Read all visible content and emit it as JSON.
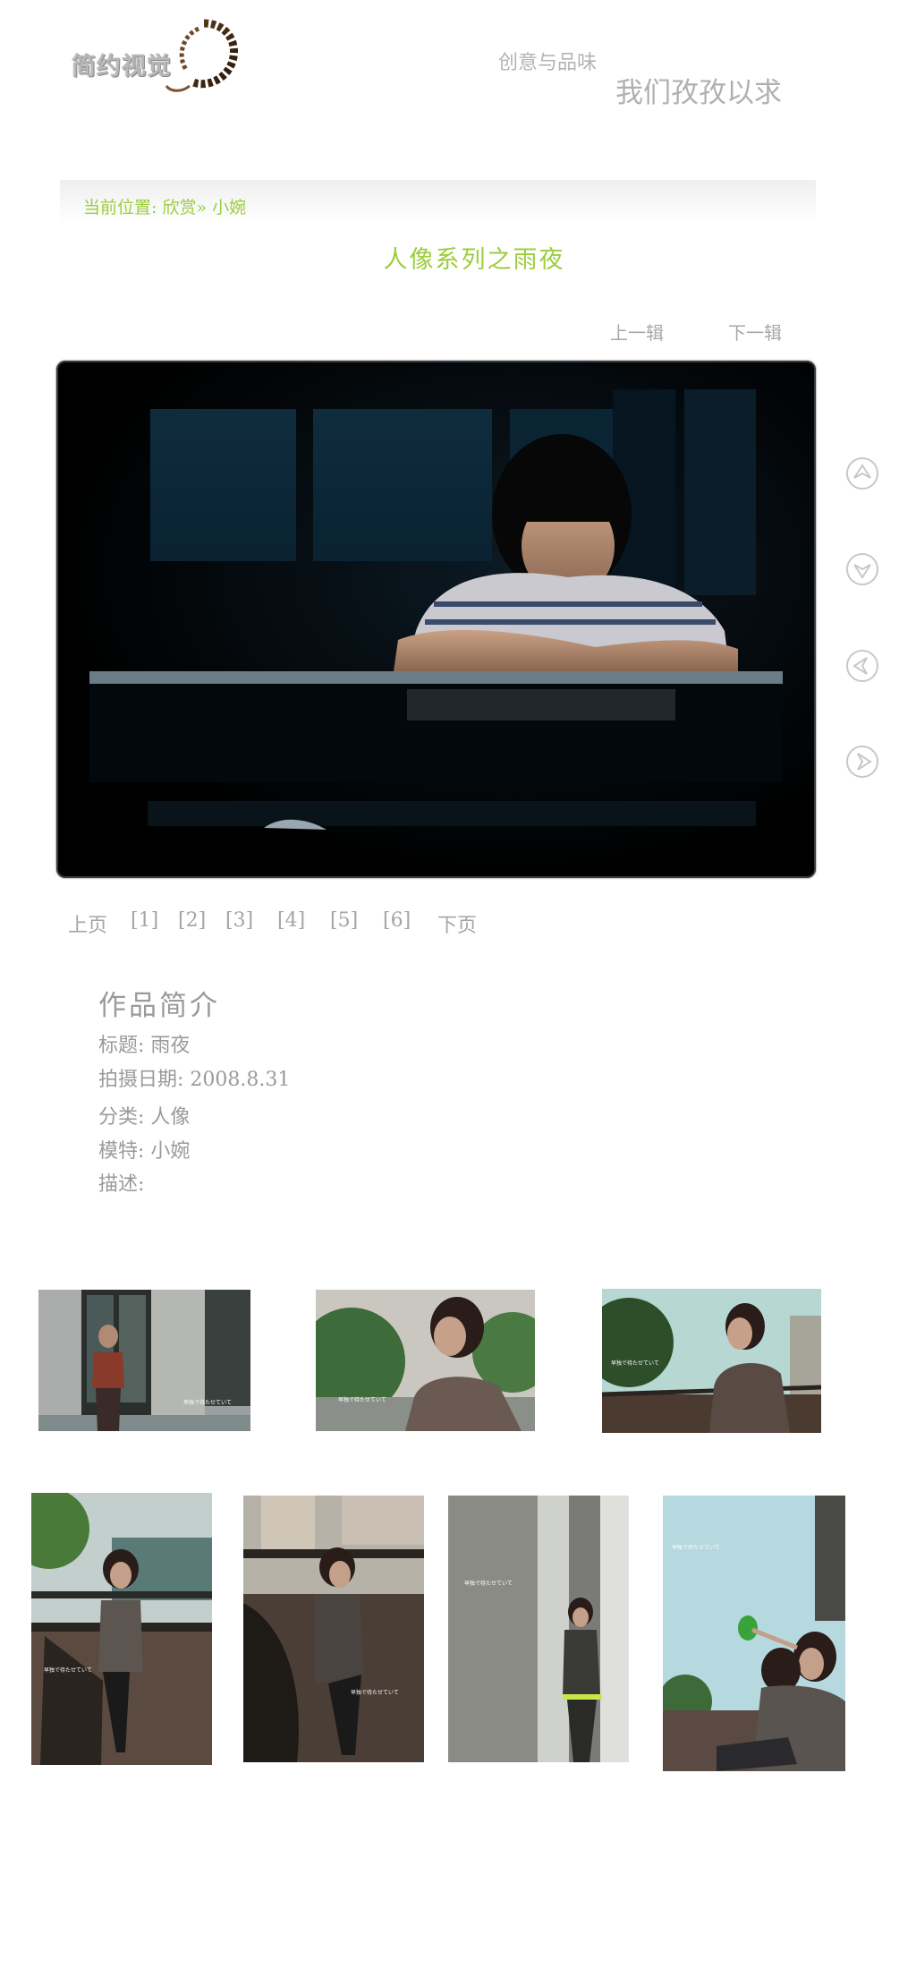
{
  "header": {
    "logo_text": "简约视觉",
    "tagline_small": "创意与品味",
    "tagline_big": "我们孜孜以求"
  },
  "breadcrumb": {
    "prefix": "当前位置:",
    "section": "欣赏»",
    "current": "小婉"
  },
  "album": {
    "title": "人像系列之雨夜",
    "prev_label": "上一辑",
    "next_label": "下一辑"
  },
  "side_nav": {
    "icons": [
      "arrow-up-circle-icon",
      "arrow-down-circle-icon",
      "arrow-left-circle-icon",
      "arrow-right-circle-icon"
    ]
  },
  "pagination": {
    "prev": "上页",
    "pages": [
      "[1]",
      "[2]",
      "[3]",
      "[4]",
      "[5]",
      "[6]"
    ],
    "next": "下页"
  },
  "info": {
    "heading": "作品简介",
    "title_label": "标题:",
    "title_value": "雨夜",
    "date_label": "拍摄日期:",
    "date_value": "2008.8.31",
    "category_label": "分类:",
    "category_value": "人像",
    "model_label": "模特:",
    "model_value": "小婉",
    "desc_label": "描述:",
    "desc_value": ""
  },
  "thumbnails": {
    "watermark": "早独で待たせていて"
  },
  "colors": {
    "accent_green": "#9ccd3c",
    "text_gray": "#9a9a9a"
  }
}
